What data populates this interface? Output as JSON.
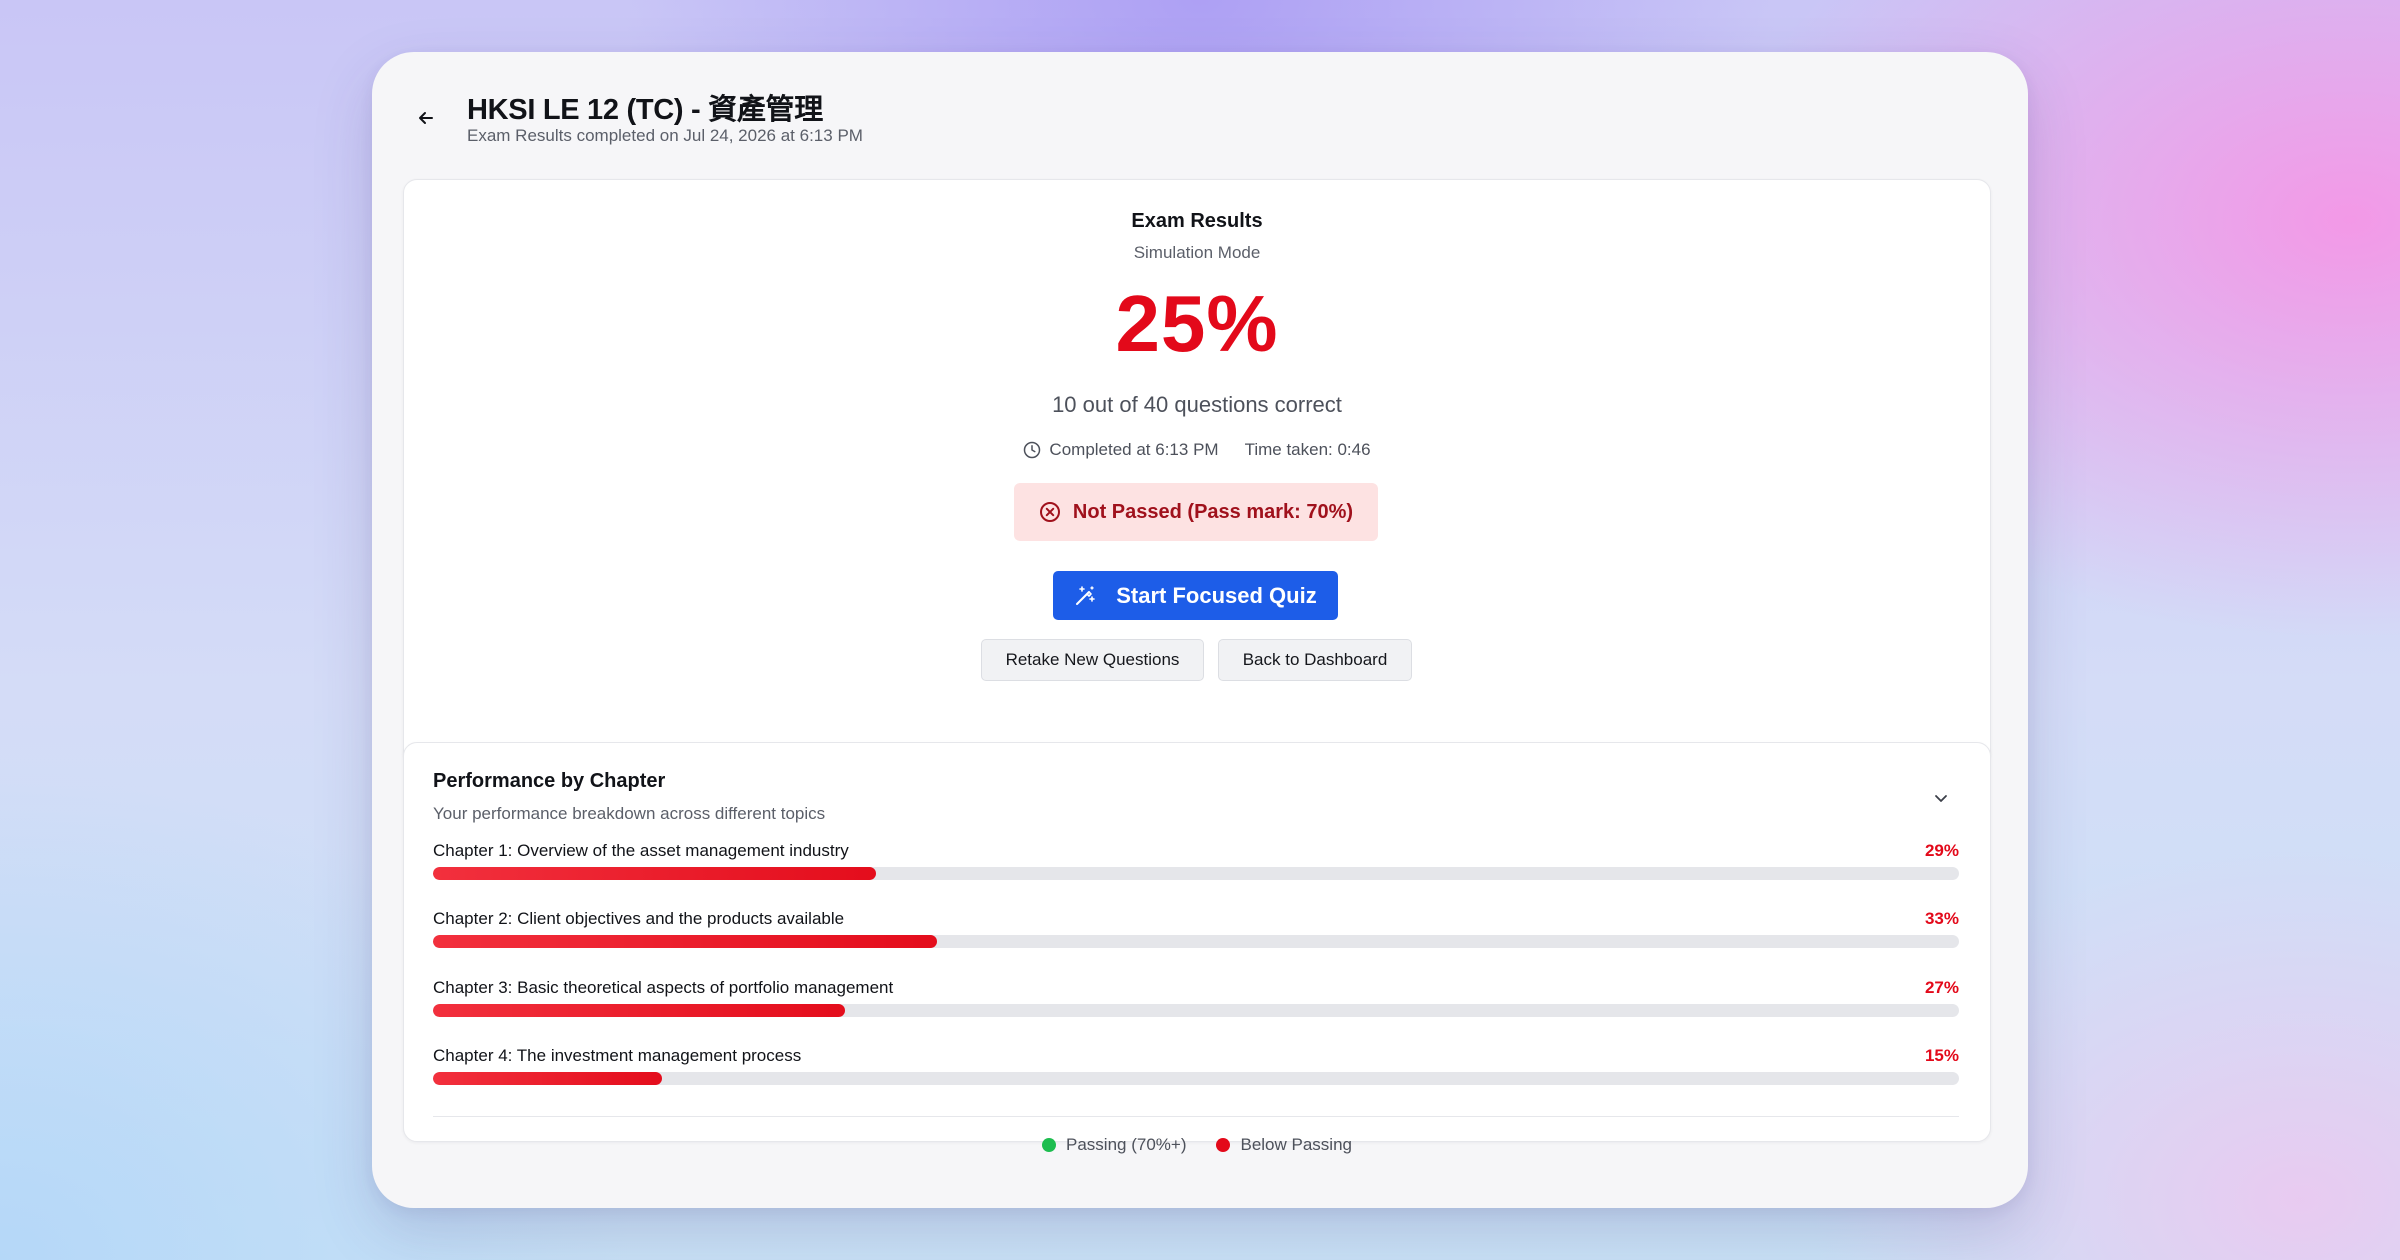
{
  "header": {
    "title": "HKSI LE 12 (TC) - 資產管理",
    "subtitle": "Exam Results completed on Jul 24, 2026 at 6:13 PM"
  },
  "results": {
    "title": "Exam Results",
    "mode": "Simulation Mode",
    "score": "25%",
    "correct_text": "10 out of 40 questions correct",
    "completed": "Completed at 6:13 PM",
    "time_taken": "Time taken: 0:46",
    "status": "Not Passed (Pass mark: 70%)",
    "primary_action": "Start Focused Quiz",
    "retake_label": "Retake New Questions",
    "dashboard_label": "Back to Dashboard"
  },
  "performance": {
    "title": "Performance by Chapter",
    "subtitle": "Your performance breakdown across different topics",
    "chapters": [
      {
        "label": "Chapter 1: Overview of the asset management industry",
        "percent_label": "29%",
        "percent": 29
      },
      {
        "label": "Chapter 2: Client objectives and the products available",
        "percent_label": "33%",
        "percent": 33
      },
      {
        "label": "Chapter 3: Basic theoretical aspects of portfolio management",
        "percent_label": "27%",
        "percent": 27
      },
      {
        "label": "Chapter 4: The investment management process",
        "percent_label": "15%",
        "percent": 15
      }
    ],
    "legend": {
      "passing": "Passing (70%+)",
      "below": "Below Passing"
    }
  },
  "colors": {
    "fail": "#e3091a",
    "pass": "#1dbd4f",
    "primary": "#1d5de8",
    "fail_badge_bg": "#fde2e2"
  },
  "icons": {
    "back": "arrow-left-icon",
    "clock": "clock-icon",
    "status": "x-circle-icon",
    "quiz": "magic-wand-icon",
    "collapse": "chevron-down-icon"
  }
}
